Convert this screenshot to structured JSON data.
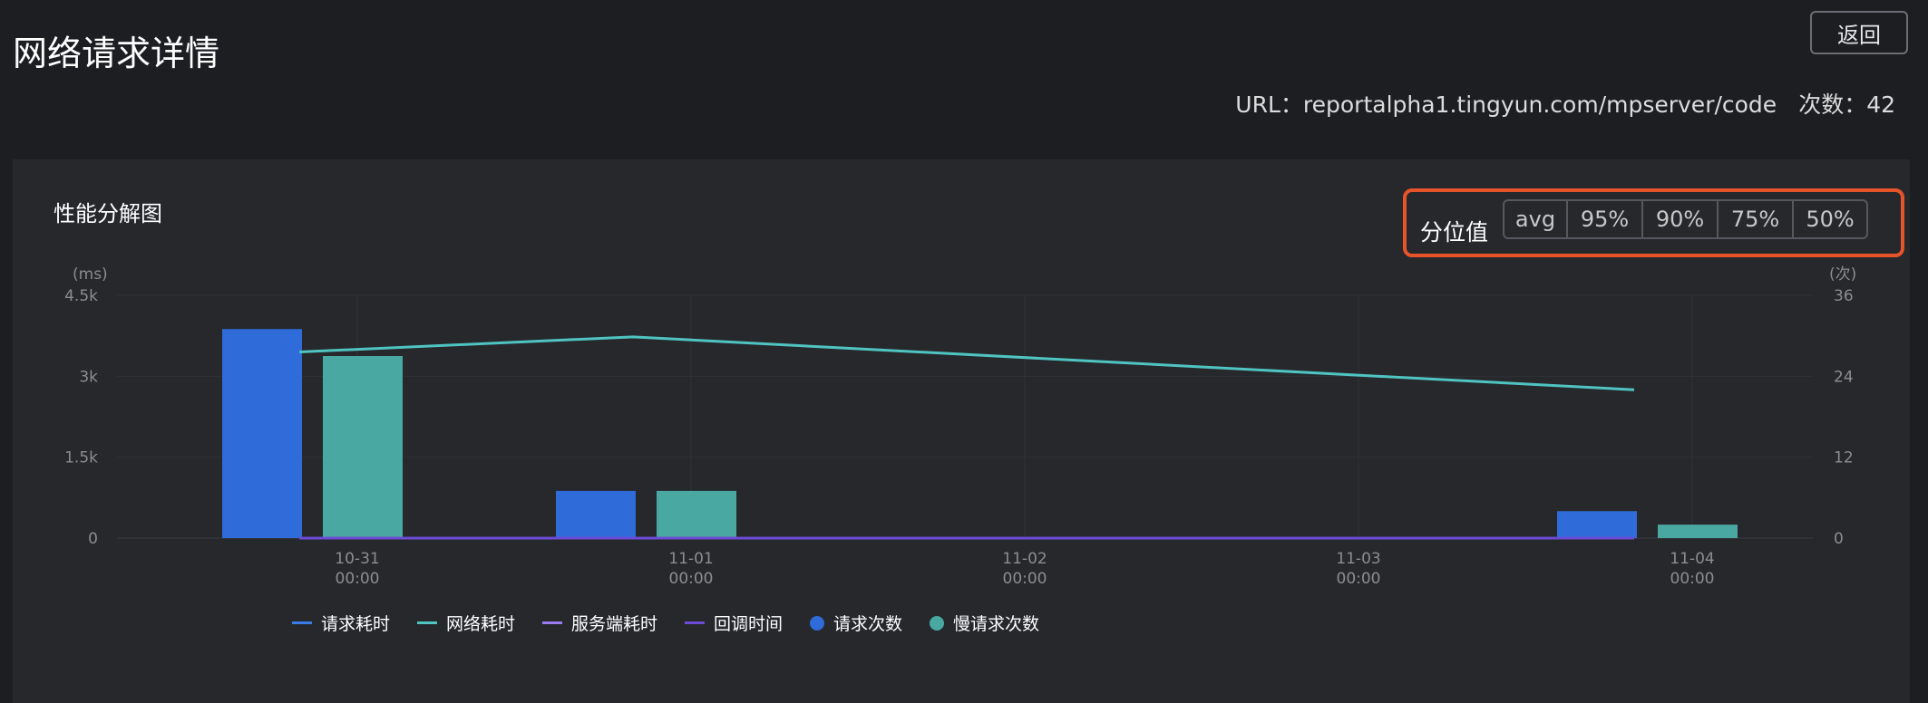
{
  "header": {
    "title": "网络请求详情",
    "back_label": "返回",
    "url_text": "URL：reportalpha1.tingyun.com/mpserver/code",
    "count_text": "次数：42"
  },
  "panel": {
    "title": "性能分解图",
    "percentile_label": "分位值",
    "percentile_options": [
      "avg",
      "95%",
      "90%",
      "75%",
      "50%"
    ],
    "highlight_color": "#e8542a"
  },
  "chart_data": {
    "type": "bar",
    "categories": [
      "10-31\n00:00",
      "11-01\n00:00",
      "11-02\n00:00",
      "11-03\n00:00",
      "11-04\n00:00"
    ],
    "y_left": {
      "unit_label": "(ms)",
      "ylim": [
        0,
        4500
      ],
      "ticks": [
        "0",
        "1.5k",
        "3k",
        "4.5k"
      ],
      "tick_values": [
        0,
        1500,
        3000,
        4500
      ]
    },
    "y_right": {
      "unit_label": "(次)",
      "ylim": [
        0,
        36
      ],
      "ticks": [
        "0",
        "12",
        "24",
        "36"
      ],
      "tick_values": [
        0,
        12,
        24,
        36
      ]
    },
    "bar_series": [
      {
        "name": "请求次数",
        "axis": "right",
        "color": "#2f6bd9",
        "values": [
          31,
          7,
          null,
          null,
          4
        ]
      },
      {
        "name": "慢请求次数",
        "axis": "right",
        "color": "#4aa8a3",
        "values": [
          27,
          7,
          null,
          null,
          2
        ]
      }
    ],
    "line_series": [
      {
        "name": "请求耗时",
        "axis": "left",
        "color": "#3b7be8",
        "points": [
          [
            0,
            0
          ],
          [
            1,
            0
          ],
          [
            4,
            0
          ]
        ]
      },
      {
        "name": "网络耗时",
        "axis": "left",
        "color": "#4fc4c1",
        "points": [
          [
            0,
            3450
          ],
          [
            1,
            3730
          ],
          [
            4,
            2750
          ]
        ]
      },
      {
        "name": "服务端耗时",
        "axis": "left",
        "color": "#9b7cf0",
        "points": [
          [
            0,
            0
          ],
          [
            1,
            0
          ],
          [
            4,
            0
          ]
        ]
      },
      {
        "name": "回调时间",
        "axis": "left",
        "color": "#6c4bd6",
        "points": [
          [
            0,
            0
          ],
          [
            1,
            0
          ],
          [
            4,
            0
          ]
        ]
      }
    ],
    "legend": [
      {
        "label": "请求耗时",
        "kind": "line",
        "color": "#3b7be8"
      },
      {
        "label": "网络耗时",
        "kind": "line",
        "color": "#4fc4c1"
      },
      {
        "label": "服务端耗时",
        "kind": "line",
        "color": "#9b7cf0"
      },
      {
        "label": "回调时间",
        "kind": "line",
        "color": "#6c4bd6"
      },
      {
        "label": "请求次数",
        "kind": "dot",
        "color": "#2f6bd9"
      },
      {
        "label": "慢请求次数",
        "kind": "dot",
        "color": "#4aa8a3"
      }
    ],
    "legend_position": "bottom-center",
    "grid": true
  }
}
